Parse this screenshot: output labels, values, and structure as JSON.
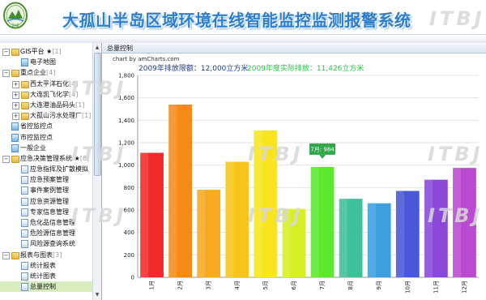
{
  "app": {
    "title": "大孤山半岛区域环境在线智能监控监测报警系统"
  },
  "watermark": "ITBJ",
  "tree": [
    {
      "label": "GIS平台 ★",
      "count": "[1]",
      "level": 0,
      "expand": "−",
      "icon": "folder",
      "star": true
    },
    {
      "label": "电子地图",
      "count": "",
      "level": 1,
      "expand": "",
      "icon": "leaf"
    },
    {
      "label": "重点企业",
      "count": "[4]",
      "level": 0,
      "expand": "−",
      "icon": "folder"
    },
    {
      "label": "西太平洋石化",
      "count": "[4]",
      "level": 1,
      "expand": "+",
      "icon": "folder"
    },
    {
      "label": "大连凯飞化学",
      "count": "[4]",
      "level": 1,
      "expand": "+",
      "icon": "folder"
    },
    {
      "label": "大连港油品码头",
      "count": "[1]",
      "level": 1,
      "expand": "+",
      "icon": "folder"
    },
    {
      "label": "大孤山污水处理厂",
      "count": "[1]",
      "level": 1,
      "expand": "+",
      "icon": "folder"
    },
    {
      "label": "省控监控点",
      "count": "",
      "level": 0,
      "expand": "",
      "icon": "leaf"
    },
    {
      "label": "市控监控点",
      "count": "",
      "level": 0,
      "expand": "",
      "icon": "leaf"
    },
    {
      "label": "一般企业",
      "count": "",
      "level": 0,
      "expand": "",
      "icon": "leaf"
    },
    {
      "label": "应急决策管理系统 ★",
      "count": "[8]",
      "level": 0,
      "expand": "−",
      "icon": "folder"
    },
    {
      "label": "应急指挥及扩散模拟",
      "count": "",
      "level": 1,
      "expand": "",
      "icon": "doc"
    },
    {
      "label": "应急预案管理",
      "count": "",
      "level": 1,
      "expand": "",
      "icon": "doc"
    },
    {
      "label": "事件案例管理",
      "count": "",
      "level": 1,
      "expand": "",
      "icon": "doc"
    },
    {
      "label": "应急资源管理",
      "count": "",
      "level": 1,
      "expand": "",
      "icon": "doc"
    },
    {
      "label": "专家信息管理",
      "count": "",
      "level": 1,
      "expand": "",
      "icon": "doc"
    },
    {
      "label": "危化品信息管理",
      "count": "",
      "level": 1,
      "expand": "",
      "icon": "doc"
    },
    {
      "label": "危险源信息管理",
      "count": "",
      "level": 1,
      "expand": "",
      "icon": "doc"
    },
    {
      "label": "风险源查询系统",
      "count": "",
      "level": 1,
      "expand": "",
      "icon": "doc"
    },
    {
      "label": "报表与图表",
      "count": "[3]",
      "level": 0,
      "expand": "−",
      "icon": "folder"
    },
    {
      "label": "统计报表",
      "count": "",
      "level": 1,
      "expand": "",
      "icon": "doc"
    },
    {
      "label": "统计图表",
      "count": "",
      "level": 1,
      "expand": "",
      "icon": "doc"
    },
    {
      "label": "总量控制",
      "count": "",
      "level": 1,
      "expand": "",
      "icon": "doc",
      "selected": true
    }
  ],
  "main": {
    "tab_title": "总量控制",
    "credit": "chart by amCharts.com",
    "annotation_limit": "2009年排放限额：12,000立方米",
    "annotation_actual": "2009年度实际排放：11,426立方米",
    "tooltip": "7月: 984"
  },
  "chart_data": {
    "type": "bar",
    "categories": [
      "1月",
      "2月",
      "3月",
      "4月",
      "5月",
      "6月",
      "7月",
      "8月",
      "9月",
      "10月",
      "11月",
      "12月"
    ],
    "values": [
      1110,
      1540,
      780,
      1030,
      1310,
      610,
      984,
      700,
      660,
      770,
      870,
      975
    ],
    "colors": [
      "#f2292b",
      "#f58a17",
      "#f7a91f",
      "#f7c51a",
      "#f8e51e",
      "#d7f025",
      "#5ce82d",
      "#3fbf9a",
      "#3d9fe0",
      "#4858d6",
      "#8a49d8",
      "#b94ad1"
    ],
    "yticks": [
      "0",
      "200",
      "400",
      "600",
      "800",
      "1,000",
      "1,200",
      "1,400",
      "1,600",
      "1,800"
    ],
    "ylim": [
      0,
      1800
    ]
  }
}
